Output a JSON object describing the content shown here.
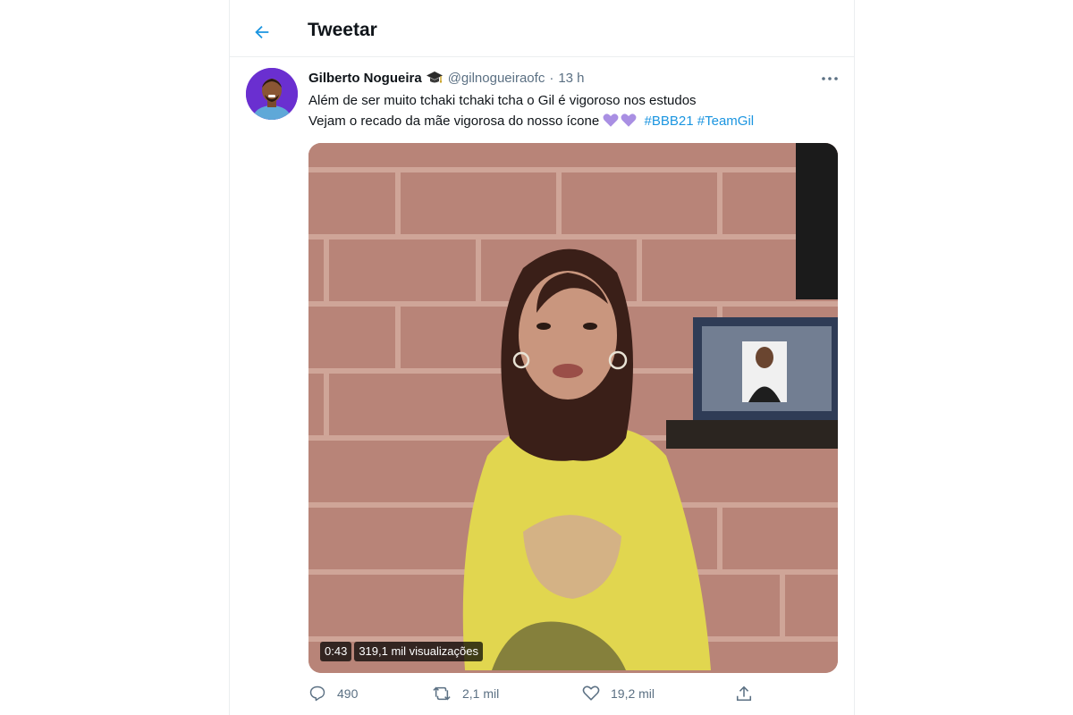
{
  "header": {
    "title": "Tweetar"
  },
  "tweet": {
    "author_name": "Gilberto Nogueira",
    "handle": "@gilnogueiraofc",
    "separator": "·",
    "time": "13 h",
    "line1": "Além de ser muito tchaki tchaki tcha o Gil é vigoroso nos estudos",
    "line2": "Vejam o recado da mãe vigorosa do nosso ícone",
    "hashtags": [
      "#BBB21",
      "#TeamGil"
    ],
    "video_duration": "0:43",
    "video_views": "319,1 mil visualizações",
    "replies": "490",
    "retweets": "2,1 mil",
    "likes": "19,2 mil"
  },
  "colors": {
    "accent": "#1b95e0",
    "muted": "#5b7083",
    "heart_emoji": "#a98fe3",
    "avatar_bg": "#6a2fd0"
  },
  "icons": [
    "back-arrow-icon",
    "graduation-cap-icon",
    "more-icon",
    "purple-heart-icon",
    "reply-icon",
    "retweet-icon",
    "like-icon",
    "share-icon"
  ]
}
